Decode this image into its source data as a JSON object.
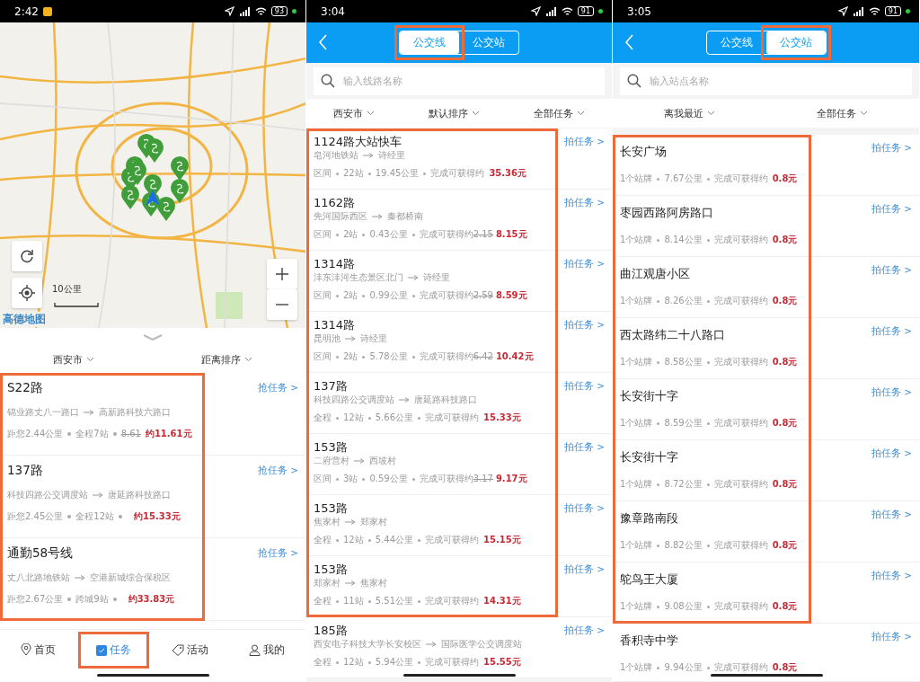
{
  "map_screen": {
    "status_bar": {
      "time": "2:42",
      "battery": "93"
    },
    "map": {
      "scale_label": "10公里",
      "logo": "高德地图"
    },
    "filters": [
      {
        "label": "西安市"
      },
      {
        "label": "距离排序"
      }
    ],
    "framed_rows": [
      {
        "title": "S22路",
        "from": "锦业路丈八一路口",
        "to": "高新路科技六路口",
        "distance": "距您2.44公里",
        "stops": "全程7站",
        "old_price": "8.61",
        "price": "约11.61元",
        "action": "抢任务 >"
      },
      {
        "title": "137路",
        "from": "科技四路公交调度站",
        "to": "唐延路科技路口",
        "distance": "距您2.45公里",
        "stops": "全程12站",
        "price": "约15.33元",
        "action": "抢任务 >"
      },
      {
        "title": "通勤58号线",
        "from": "丈八北路地铁站",
        "to": "空港新城综合保税区",
        "distance": "距您2.67公里",
        "stops": "跨城9站",
        "price": "约33.83元",
        "action": "抢任务 >"
      }
    ],
    "nav": [
      {
        "label": "首页",
        "selected": false,
        "highlighted": false
      },
      {
        "label": "任务",
        "selected": true,
        "highlighted": true
      },
      {
        "label": "活动",
        "selected": false,
        "highlighted": false
      },
      {
        "label": "我的",
        "selected": false,
        "highlighted": false
      }
    ]
  },
  "line_screen": {
    "status_bar": {
      "time": "3:04",
      "battery": "91"
    },
    "tabs": [
      {
        "label": "公交线",
        "selected": true,
        "highlighted": true
      },
      {
        "label": "公交站",
        "selected": false,
        "highlighted": false
      }
    ],
    "search": {
      "placeholder": "输入线路名称"
    },
    "filters": [
      {
        "label": "西安市"
      },
      {
        "label": "默认排序"
      },
      {
        "label": "全部任务"
      }
    ],
    "framed_rows": [
      {
        "title": "1124路大站快车",
        "from": "皂河地铁站",
        "to": "诗经里",
        "scope": "区间",
        "stops": "22站",
        "length": "19.45公里",
        "reward_label": "完成可获得约",
        "price": "35.36元",
        "action": "拍任务 >"
      },
      {
        "title": "1162路",
        "from": "先河国际西区",
        "to": "秦都桥南",
        "scope": "区间",
        "stops": "2站",
        "length": "0.43公里",
        "reward_label": "完成可获得约",
        "old_price": "2.15",
        "price": "8.15元",
        "action": "拍任务 >"
      },
      {
        "title": "1314路",
        "from": "沣东沣河生态景区北门",
        "to": "诗经里",
        "scope": "区间",
        "stops": "2站",
        "length": "0.99公里",
        "reward_label": "完成可获得约",
        "old_price": "2.59",
        "price": "8.59元",
        "action": "拍任务 >"
      },
      {
        "title": "1314路",
        "from": "昆明池",
        "to": "诗经里",
        "scope": "区间",
        "stops": "2站",
        "length": "5.78公里",
        "reward_label": "完成可获得约",
        "old_price": "6.42",
        "price": "10.42元",
        "action": "拍任务 >"
      },
      {
        "title": "137路",
        "from": "科技四路公交调度站",
        "to": "唐延路科技路口",
        "scope": "全程",
        "stops": "12站",
        "length": "5.66公里",
        "reward_label": "完成可获得约",
        "price": "15.33元",
        "action": "拍任务 >"
      },
      {
        "title": "153路",
        "from": "二府营村",
        "to": "西坡村",
        "scope": "区间",
        "stops": "3站",
        "length": "0.59公里",
        "reward_label": "完成可获得约",
        "old_price": "3.17",
        "price": "9.17元",
        "action": "拍任务 >"
      },
      {
        "title": "153路",
        "from": "焦家村",
        "to": "郑家村",
        "scope": "全程",
        "stops": "12站",
        "length": "5.44公里",
        "reward_label": "完成可获得约",
        "price": "15.15元",
        "action": "拍任务 >"
      },
      {
        "title": "153路",
        "from": "郑家村",
        "to": "焦家村",
        "scope": "全程",
        "stops": "11站",
        "length": "5.51公里",
        "reward_label": "完成可获得约",
        "price": "14.31元",
        "action": "拍任务 >"
      }
    ],
    "rows": [
      {
        "title": "185路",
        "from": "西安电子科技大学长安校区",
        "to": "国际医学公交调度站",
        "scope": "全程",
        "stops": "12站",
        "length": "5.94公里",
        "reward_label": "完成可获得约",
        "price": "15.55元",
        "action": "拍任务 >"
      }
    ]
  },
  "station_screen": {
    "status_bar": {
      "time": "3:05",
      "battery": "91"
    },
    "tabs": [
      {
        "label": "公交线",
        "selected": false,
        "highlighted": false
      },
      {
        "label": "公交站",
        "selected": true,
        "highlighted": true
      }
    ],
    "search": {
      "placeholder": "输入站点名称"
    },
    "filters": [
      {
        "label": "离我最近"
      },
      {
        "label": "全部任务"
      }
    ],
    "framed_rows": [
      {
        "name": "长安广场",
        "signs": "1个站牌",
        "distance": "7.67公里",
        "reward_label": "完成可获得约",
        "price": "0.8元",
        "action": "拍任务 >"
      },
      {
        "name": "枣园西路阿房路口",
        "signs": "1个站牌",
        "distance": "8.14公里",
        "reward_label": "完成可获得约",
        "price": "0.8元",
        "action": "拍任务 >"
      },
      {
        "name": "曲江观唐小区",
        "signs": "1个站牌",
        "distance": "8.26公里",
        "reward_label": "完成可获得约",
        "price": "0.8元",
        "action": "拍任务 >"
      },
      {
        "name": "西太路纬二十八路口",
        "signs": "1个站牌",
        "distance": "8.58公里",
        "reward_label": "完成可获得约",
        "price": "0.8元",
        "action": "拍任务 >"
      },
      {
        "name": "长安街十字",
        "signs": "1个站牌",
        "distance": "8.59公里",
        "reward_label": "完成可获得约",
        "price": "0.8元",
        "action": "拍任务 >"
      },
      {
        "name": "长安街十字",
        "signs": "1个站牌",
        "distance": "8.72公里",
        "reward_label": "完成可获得约",
        "price": "0.8元",
        "action": "拍任务 >"
      },
      {
        "name": "豫章路南段",
        "signs": "1个站牌",
        "distance": "8.82公里",
        "reward_label": "完成可获得约",
        "price": "0.8元",
        "action": "拍任务 >"
      },
      {
        "name": "鸵鸟王大厦",
        "signs": "1个站牌",
        "distance": "9.08公里",
        "reward_label": "完成可获得约",
        "price": "0.8元",
        "action": "拍任务 >"
      }
    ],
    "rows": [
      {
        "name": "香积寺中学",
        "signs": "1个站牌",
        "distance": "9.94公里",
        "reward_label": "完成可获得约",
        "price": "0.8元",
        "action": "拍任务 >"
      }
    ]
  }
}
